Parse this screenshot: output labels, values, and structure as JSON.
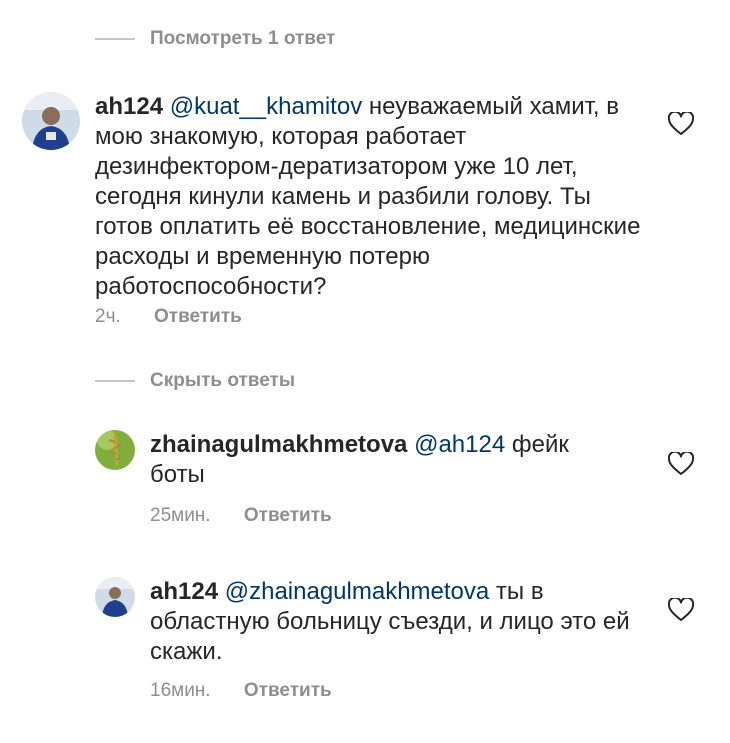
{
  "thread1": {
    "toggle_label": "Посмотреть 1 ответ"
  },
  "thread2": {
    "toggle_label": "Скрыть ответы"
  },
  "comments": [
    {
      "username": "ah124",
      "mention": "@kuat__khamitov",
      "text": "неуважаемый хамит, в мою знакомую, которая работает дезинфектором-дератизатором уже 10 лет, сегодня кинули камень и разбили голову. Ты готов оплатить её восстановление, медицинские расходы и временную потерю работоспособности?",
      "time": "2ч.",
      "reply_label": "Ответить",
      "like_icon": "heart-outline"
    },
    {
      "username": "zhainagulmakhmetova",
      "mention": "@ah124",
      "text": "фейк боты",
      "time": "25мин.",
      "reply_label": "Ответить",
      "like_icon": "heart-outline"
    },
    {
      "username": "ah124",
      "mention": "@zhainagulmakhmetova",
      "text": "ты в областную больницу съезди, и лицо это ей скажи.",
      "time": "16мин.",
      "reply_label": "Ответить",
      "like_icon": "heart-outline"
    }
  ]
}
